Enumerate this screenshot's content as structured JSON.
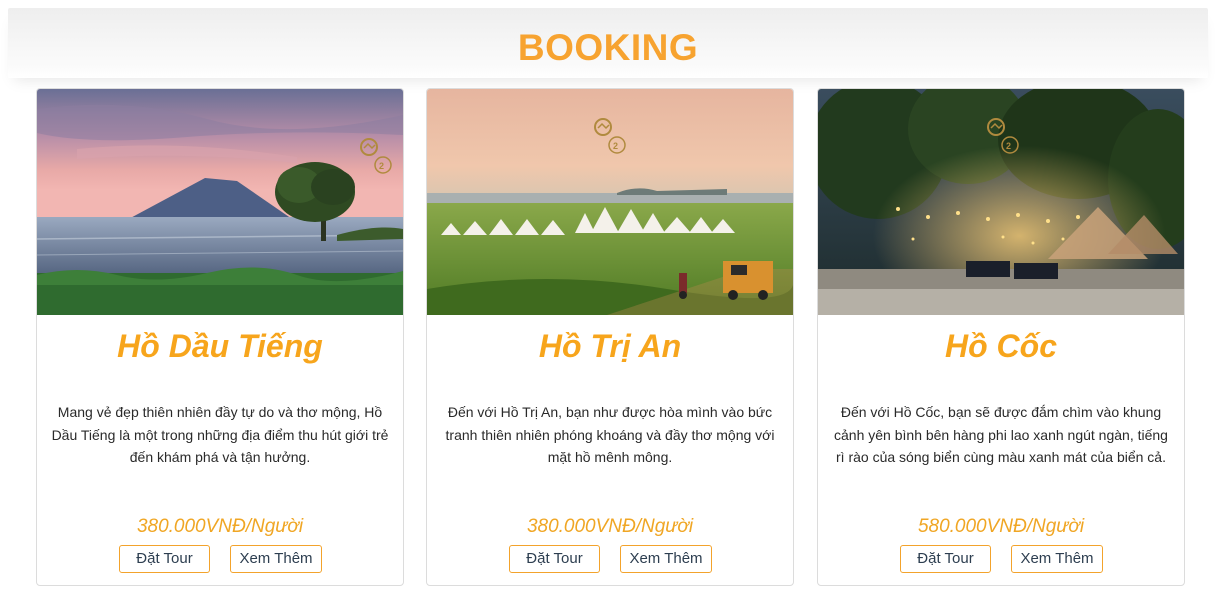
{
  "section": {
    "title": "BOOKING"
  },
  "tours": [
    {
      "name": "Hồ Dầu Tiếng",
      "description": "Mang vẻ đẹp thiên nhiên đầy tự do và thơ mộng, Hồ Dầu Tiếng là một trong những địa điểm thu hút giới trẻ đến khám phá và tận hưởng.",
      "price": "380.000VNĐ/Người",
      "book_label": "Đặt Tour",
      "more_label": "Xem Thêm"
    },
    {
      "name": "Hồ Trị An",
      "description": "Đến với Hồ Trị An, bạn như được hòa mình vào bức tranh thiên nhiên phóng khoáng và đầy thơ mộng với mặt hồ mênh mông.",
      "price": "380.000VNĐ/Người",
      "book_label": "Đặt Tour",
      "more_label": "Xem Thêm"
    },
    {
      "name": "Hồ Cốc",
      "description": "Đến với Hồ Cốc, bạn sẽ được đắm chìm vào khung cảnh yên bình bên hàng phi lao xanh ngút ngàn, tiếng rì rào của sóng biển cùng màu xanh mát của biển cả.",
      "price": "580.000VNĐ/Người",
      "book_label": "Đặt Tour",
      "more_label": "Xem Thêm"
    }
  ],
  "colors": {
    "accent": "#f7a330",
    "price": "#f0a624",
    "button_border": "#f3a32c",
    "text": "#2a2a2a"
  }
}
